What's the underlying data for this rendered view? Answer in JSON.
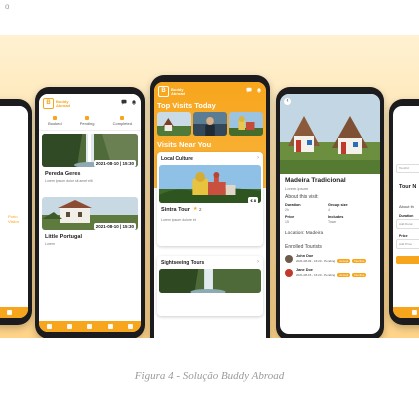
{
  "corner_mark": "o",
  "caption": "Figura 4 - Solução Buddy Abroad",
  "colors": {
    "accent": "#f7a51c",
    "banner_top": "#fff1d2",
    "banner_bottom": "#ffd489",
    "phone": "#1c1c1e"
  },
  "brand": {
    "logo_letter": "B",
    "line1": "Buddy",
    "line2": "Abroad"
  },
  "phone_far_left": {
    "side_text": "Porto\nVisitor"
  },
  "phone_left": {
    "tabs": [
      "Booked",
      "Pending",
      "Completed"
    ],
    "cards": [
      {
        "title": "Pereda Geres",
        "desc": "Lorem ipsum dolor sit amet elit",
        "date": "2021-08-10 | 15:30"
      },
      {
        "title": "Little Portugal",
        "desc": "Lorem",
        "date": "2021-08-10 | 15:30"
      }
    ]
  },
  "phone_center": {
    "section_top": "Top Visits Today",
    "section_near": "Visits Near You",
    "category_1": "Local Culture",
    "tour_title": "Sintra Tour",
    "tour_rating": "2",
    "tour_price": "€ 8",
    "tour_desc": "Lorem ipsum dolore et",
    "category_2": "Sightseeing Tours"
  },
  "phone_right": {
    "title": "Madeira Tradicional",
    "subtitle": "Lorem ipsum",
    "about": "About this visit:",
    "duration_label": "Duration",
    "duration_value": "2h",
    "group_label": "Group size",
    "group_value": "4",
    "price_label": "Price",
    "price_value": "15",
    "includes_label": "Includes",
    "includes_value": "Town",
    "location": "Location: Madeira",
    "enrolled": "Enrolled Tourists",
    "tourists": [
      {
        "name": "John Doe",
        "detail": "2021-08-09 - 16:20 - Pending",
        "accept": "Accept",
        "decline": "Decline"
      },
      {
        "name": "Jane Doe",
        "detail": "2021-08-15 - 16:20 - Pending",
        "accept": "Accept",
        "decline": "Decline"
      }
    ]
  },
  "phone_far_right": {
    "title": "Tour N",
    "about": "About th",
    "duration_label": "Duration",
    "duration_placeholder": "Add Durat",
    "price_label": "Price",
    "price_placeholder": "Add Price",
    "field_placeholder": "Touchd"
  }
}
